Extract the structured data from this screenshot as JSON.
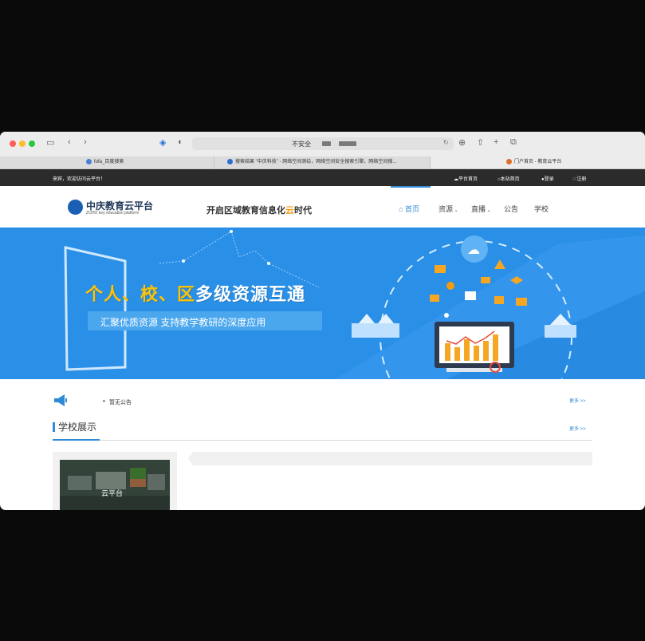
{
  "browser": {
    "url_label": "不安全",
    "tabs": [
      {
        "title": "fofa_百度搜索"
      },
      {
        "title": "搜索结果 \"中庆科技\" - 网络空间测绘，网络空间安全搜索引擎，网络空间搜..."
      },
      {
        "title": "门户首页 - 教育云平台"
      }
    ]
  },
  "topbar": {
    "welcome": "来宾，欢迎访问云平台！",
    "links": [
      "平台首页",
      "本站首页",
      "登录",
      "注册"
    ]
  },
  "header": {
    "logo_cn": "中庆教育云平台",
    "logo_en": "ZOHO key education platform",
    "slogan_pre": "开启区域教育信息化",
    "slogan_hl": "云",
    "slogan_post": "时代",
    "nav": {
      "home": "首页",
      "resources": "资源",
      "live": "直播",
      "notice": "公告",
      "school": "学校"
    }
  },
  "banner": {
    "headline_part1": "个人、校、区",
    "headline_part2": "多级资源互通",
    "subline": "汇聚优质资源 支持教学教研的深度应用"
  },
  "notice": {
    "text": "暂无公告",
    "more": "更多 >>"
  },
  "schools": {
    "title": "学校展示",
    "more": "更多 >>",
    "card_label": "云平台"
  },
  "colors": {
    "accent": "#2e8ad6",
    "topbar": "#2b2b2b",
    "banner": "#2a8fe6",
    "highlight": "#ffc300"
  }
}
